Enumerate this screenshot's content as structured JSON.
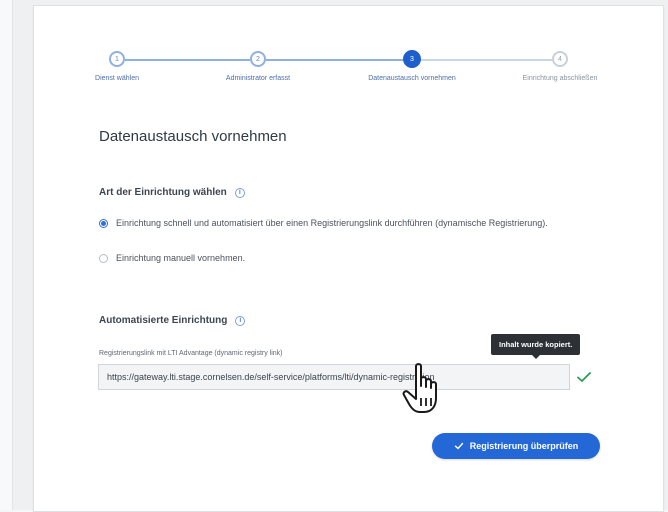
{
  "stepper": {
    "steps": [
      {
        "number": "1",
        "label": "Dienst wählen",
        "state": "done"
      },
      {
        "number": "2",
        "label": "Administrator erfasst",
        "state": "done"
      },
      {
        "number": "3",
        "label": "Datenaustausch vornehmen",
        "state": "active"
      },
      {
        "number": "4",
        "label": "Einrichtung abschließen",
        "state": "todo"
      }
    ]
  },
  "page_title": "Datenaustausch vornehmen",
  "setup_type": {
    "heading": "Art der Einrichtung wählen",
    "info_icon": "info-icon",
    "options": [
      {
        "label": "Einrichtung schnell und automatisiert über einen Registrierungslink durchführen (dynamische Registrierung).",
        "selected": true
      },
      {
        "label": "Einrichtung manuell vornehmen.",
        "selected": false
      }
    ]
  },
  "automated": {
    "heading": "Automatisierte Einrichtung",
    "field_label": "Registrierungslink mit LTI Advantage (dynamic registry link)",
    "url_value": "https://gateway.lti.stage.cornelsen.de/self-service/platforms/lti/dynamic-registration",
    "tooltip": "Inhalt wurde kopiert.",
    "copied_icon": "check-icon"
  },
  "actions": {
    "check_label": "Registrierung überprüfen",
    "check_icon": "checkmark-icon"
  },
  "colors": {
    "accent": "#2468d8",
    "tooltip_bg": "#2d3136",
    "success": "#2a9d55"
  }
}
